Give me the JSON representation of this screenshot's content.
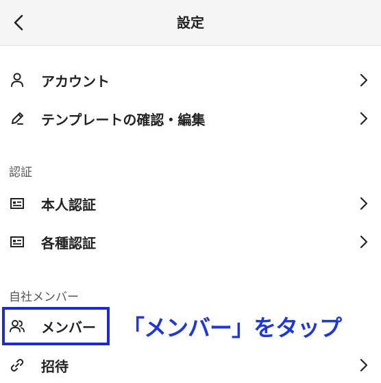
{
  "header": {
    "title": "設定",
    "back_icon": "chevron-left-icon"
  },
  "colors": {
    "header_bg": "#f5f5f5",
    "annotation_blue": "#1f36d9",
    "highlight_border": "#1a2bd6"
  },
  "account_section": {
    "items": [
      {
        "label": "アカウント",
        "icon": "person-icon"
      },
      {
        "label": "テンプレートの確認・編集",
        "icon": "pencil-icon"
      }
    ]
  },
  "verification_section": {
    "header": "認証",
    "items": [
      {
        "label": "本人認証",
        "icon": "id-card-icon"
      },
      {
        "label": "各種認証",
        "icon": "id-card-icon"
      }
    ]
  },
  "members_section": {
    "header": "自社メンバー",
    "items": [
      {
        "label": "メンバー",
        "icon": "people-icon"
      },
      {
        "label": "招待",
        "icon": "link-icon"
      }
    ]
  },
  "annotation": {
    "text": "「メンバー」をタップ"
  }
}
